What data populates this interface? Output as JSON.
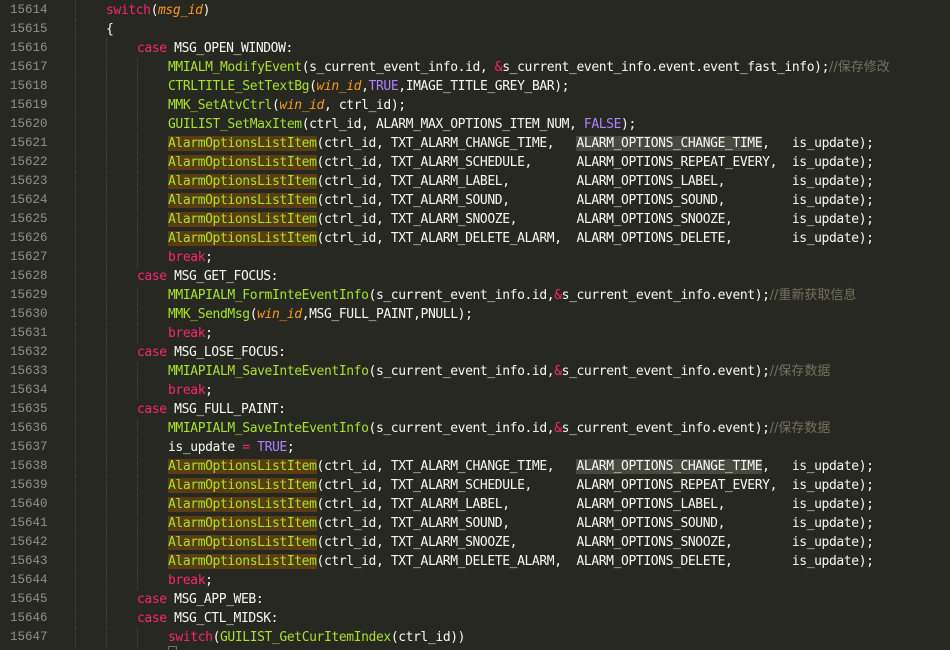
{
  "editor": {
    "theme_colors": {
      "background": "#272822",
      "keyword": "#f92672",
      "function": "#a6e22e",
      "argument": "#fd971f",
      "constant": "#ae81ff",
      "comment": "#75715e",
      "text": "#f8f8f2",
      "line_number": "#90908a",
      "highlight_bg": "#5a3e12",
      "selection_bg": "#49483e"
    },
    "lines": [
      {
        "num": "15614",
        "indent": 1,
        "tokens": [
          [
            "kw",
            "switch"
          ],
          [
            "pl",
            "("
          ],
          [
            "arg",
            "msg_id"
          ],
          [
            "pl",
            ")"
          ]
        ]
      },
      {
        "num": "15615",
        "indent": 1,
        "tokens": [
          [
            "pl",
            "{"
          ]
        ]
      },
      {
        "num": "15616",
        "indent": 2,
        "tokens": [
          [
            "kw",
            "case "
          ],
          [
            "pl",
            "MSG_OPEN_WINDOW:"
          ]
        ]
      },
      {
        "num": "15617",
        "indent": 3,
        "tokens": [
          [
            "fn",
            "MMIALM_ModifyEvent"
          ],
          [
            "pl",
            "(s_current_event_info.id, "
          ],
          [
            "op",
            "&"
          ],
          [
            "pl",
            "s_current_event_info.event.event_fast_info);"
          ],
          [
            "cm",
            "//保存修改"
          ]
        ]
      },
      {
        "num": "15618",
        "indent": 3,
        "tokens": [
          [
            "fn",
            "CTRLTITLE_SetTextBg"
          ],
          [
            "pl",
            "("
          ],
          [
            "arg",
            "win_id"
          ],
          [
            "pl",
            ","
          ],
          [
            "cst",
            "TRUE"
          ],
          [
            "pl",
            ",IMAGE_TITLE_GREY_BAR);"
          ]
        ]
      },
      {
        "num": "15619",
        "indent": 3,
        "tokens": [
          [
            "fn",
            "MMK_SetAtvCtrl"
          ],
          [
            "pl",
            "("
          ],
          [
            "arg",
            "win_id"
          ],
          [
            "pl",
            ", ctrl_id);"
          ]
        ]
      },
      {
        "num": "15620",
        "indent": 3,
        "tokens": [
          [
            "fn",
            "GUILIST_SetMaxItem"
          ],
          [
            "pl",
            "(ctrl_id, ALARM_MAX_OPTIONS_ITEM_NUM, "
          ],
          [
            "cst",
            "FALSE"
          ],
          [
            "pl",
            ");"
          ]
        ]
      },
      {
        "num": "15621",
        "indent": 3,
        "tokens": [
          [
            "fnhl",
            "AlarmOptionsListItem"
          ],
          [
            "pl",
            "(ctrl_id, TXT_ALARM_CHANGE_TIME,   "
          ],
          [
            "sel",
            "ALARM_OPTIONS_CHANGE_TIME"
          ],
          [
            "pl",
            ",   is_update);"
          ]
        ]
      },
      {
        "num": "15622",
        "indent": 3,
        "tokens": [
          [
            "fnhl",
            "AlarmOptionsListItem"
          ],
          [
            "pl",
            "(ctrl_id, TXT_ALARM_SCHEDULE,      ALARM_OPTIONS_REPEAT_EVERY,  is_update);"
          ]
        ]
      },
      {
        "num": "15623",
        "indent": 3,
        "tokens": [
          [
            "fnhl",
            "AlarmOptionsListItem"
          ],
          [
            "pl",
            "(ctrl_id, TXT_ALARM_LABEL,         ALARM_OPTIONS_LABEL,         is_update);"
          ]
        ]
      },
      {
        "num": "15624",
        "indent": 3,
        "tokens": [
          [
            "fnhl",
            "AlarmOptionsListItem"
          ],
          [
            "pl",
            "(ctrl_id, TXT_ALARM_SOUND,         ALARM_OPTIONS_SOUND,         is_update);"
          ]
        ]
      },
      {
        "num": "15625",
        "indent": 3,
        "tokens": [
          [
            "fnhl",
            "AlarmOptionsListItem"
          ],
          [
            "pl",
            "(ctrl_id, TXT_ALARM_SNOOZE,        ALARM_OPTIONS_SNOOZE,        is_update);"
          ]
        ]
      },
      {
        "num": "15626",
        "indent": 3,
        "tokens": [
          [
            "fnhl",
            "AlarmOptionsListItem"
          ],
          [
            "pl",
            "(ctrl_id, TXT_ALARM_DELETE_ALARM,  ALARM_OPTIONS_DELETE,        is_update);"
          ]
        ]
      },
      {
        "num": "15627",
        "indent": 3,
        "tokens": [
          [
            "kw",
            "break"
          ],
          [
            "pl",
            ";"
          ]
        ]
      },
      {
        "num": "15628",
        "indent": 2,
        "tokens": [
          [
            "kw",
            "case "
          ],
          [
            "pl",
            "MSG_GET_FOCUS:"
          ]
        ]
      },
      {
        "num": "15629",
        "indent": 3,
        "tokens": [
          [
            "fn",
            "MMIAPIALM_FormInteEventInfo"
          ],
          [
            "pl",
            "(s_current_event_info.id,"
          ],
          [
            "op",
            "&"
          ],
          [
            "pl",
            "s_current_event_info.event);"
          ],
          [
            "cm",
            "//重新获取信息"
          ]
        ]
      },
      {
        "num": "15630",
        "indent": 3,
        "tokens": [
          [
            "fn",
            "MMK_SendMsg"
          ],
          [
            "pl",
            "("
          ],
          [
            "arg",
            "win_id"
          ],
          [
            "pl",
            ",MSG_FULL_PAINT,PNULL);"
          ]
        ]
      },
      {
        "num": "15631",
        "indent": 3,
        "tokens": [
          [
            "kw",
            "break"
          ],
          [
            "pl",
            ";"
          ]
        ]
      },
      {
        "num": "15632",
        "indent": 2,
        "tokens": [
          [
            "kw",
            "case "
          ],
          [
            "pl",
            "MSG_LOSE_FOCUS:"
          ]
        ]
      },
      {
        "num": "15633",
        "indent": 3,
        "tokens": [
          [
            "fn",
            "MMIAPIALM_SaveInteEventInfo"
          ],
          [
            "pl",
            "(s_current_event_info.id,"
          ],
          [
            "op",
            "&"
          ],
          [
            "pl",
            "s_current_event_info.event);"
          ],
          [
            "cm",
            "//保存数据"
          ]
        ]
      },
      {
        "num": "15634",
        "indent": 3,
        "tokens": [
          [
            "kw",
            "break"
          ],
          [
            "pl",
            ";"
          ]
        ]
      },
      {
        "num": "15635",
        "indent": 2,
        "tokens": [
          [
            "kw",
            "case "
          ],
          [
            "pl",
            "MSG_FULL_PAINT:"
          ]
        ]
      },
      {
        "num": "15636",
        "indent": 3,
        "tokens": [
          [
            "fn",
            "MMIAPIALM_SaveInteEventInfo"
          ],
          [
            "pl",
            "(s_current_event_info.id,"
          ],
          [
            "op",
            "&"
          ],
          [
            "pl",
            "s_current_event_info.event);"
          ],
          [
            "cm",
            "//保存数据"
          ]
        ]
      },
      {
        "num": "15637",
        "indent": 3,
        "tokens": [
          [
            "pl",
            "is_update "
          ],
          [
            "op",
            "="
          ],
          [
            "pl",
            " "
          ],
          [
            "cst",
            "TRUE"
          ],
          [
            "pl",
            ";"
          ]
        ]
      },
      {
        "num": "15638",
        "indent": 3,
        "tokens": [
          [
            "fnhl",
            "AlarmOptionsListItem"
          ],
          [
            "pl",
            "(ctrl_id, TXT_ALARM_CHANGE_TIME,   "
          ],
          [
            "sel",
            "ALARM_OPTIONS_CHANGE_TIME"
          ],
          [
            "pl",
            ",   is_update);"
          ]
        ]
      },
      {
        "num": "15639",
        "indent": 3,
        "tokens": [
          [
            "fnhl",
            "AlarmOptionsListItem"
          ],
          [
            "pl",
            "(ctrl_id, TXT_ALARM_SCHEDULE,      ALARM_OPTIONS_REPEAT_EVERY,  is_update);"
          ]
        ]
      },
      {
        "num": "15640",
        "indent": 3,
        "tokens": [
          [
            "fnhl",
            "AlarmOptionsListItem"
          ],
          [
            "pl",
            "(ctrl_id, TXT_ALARM_LABEL,         ALARM_OPTIONS_LABEL,         is_update);"
          ]
        ]
      },
      {
        "num": "15641",
        "indent": 3,
        "tokens": [
          [
            "fnhl",
            "AlarmOptionsListItem"
          ],
          [
            "pl",
            "(ctrl_id, TXT_ALARM_SOUND,         ALARM_OPTIONS_SOUND,         is_update);"
          ]
        ]
      },
      {
        "num": "15642",
        "indent": 3,
        "tokens": [
          [
            "fnhl",
            "AlarmOptionsListItem"
          ],
          [
            "pl",
            "(ctrl_id, TXT_ALARM_SNOOZE,        ALARM_OPTIONS_SNOOZE,        is_update);"
          ]
        ]
      },
      {
        "num": "15643",
        "indent": 3,
        "tokens": [
          [
            "fnhl",
            "AlarmOptionsListItem"
          ],
          [
            "pl",
            "(ctrl_id, TXT_ALARM_DELETE_ALARM,  ALARM_OPTIONS_DELETE,        is_update);"
          ]
        ]
      },
      {
        "num": "15644",
        "indent": 3,
        "tokens": [
          [
            "kw",
            "break"
          ],
          [
            "pl",
            ";"
          ]
        ]
      },
      {
        "num": "15645",
        "indent": 2,
        "tokens": [
          [
            "kw",
            "case "
          ],
          [
            "pl",
            "MSG_APP_WEB:"
          ]
        ]
      },
      {
        "num": "15646",
        "indent": 2,
        "tokens": [
          [
            "kw",
            "case "
          ],
          [
            "pl",
            "MSG_CTL_MIDSK:"
          ]
        ]
      },
      {
        "num": "15647",
        "indent": 3,
        "tokens": [
          [
            "kw",
            "switch"
          ],
          [
            "pl",
            "("
          ],
          [
            "fn",
            "GUILIST_GetCurItemIndex"
          ],
          [
            "pl",
            "(ctrl_id))"
          ]
        ]
      }
    ]
  }
}
